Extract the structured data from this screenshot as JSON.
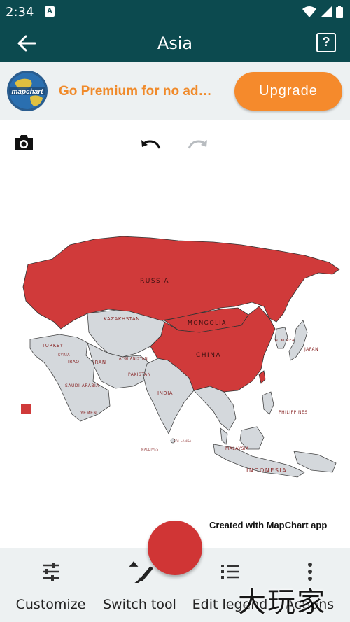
{
  "status_bar": {
    "time": "2:34",
    "notification_letter": "A"
  },
  "app_bar": {
    "title": "Asia",
    "help_symbol": "?"
  },
  "promo": {
    "logo_text": "mapchart",
    "text": "Go Premium for no ad…",
    "button_label": "Upgrade"
  },
  "toolbar": {
    "camera_icon": "camera-icon",
    "undo_icon": "undo-icon",
    "redo_icon": "redo-icon"
  },
  "map": {
    "selected_color": "#d03a3a",
    "default_color": "#d4d8dc",
    "red_labels": [
      "RUSSIA",
      "MONGOLIA",
      "CHINA"
    ],
    "labels": {
      "russia": "RUSSIA",
      "mongolia": "MONGOLIA",
      "china": "CHINA",
      "kazakhstan": "KAZAKHSTAN",
      "turkey": "TURKEY",
      "iran": "IRAN",
      "iraq": "IRAQ",
      "syria": "SYRIA",
      "saudi": "SAUDI ARABIA",
      "yemen": "YEMEN",
      "pakistan": "PAKISTAN",
      "afghanistan": "AFGHANISTAN",
      "india": "INDIA",
      "japan": "JAPAN",
      "nkorea": "N. KOREA",
      "philippines": "PHILIPPINES",
      "malaysia": "MALAYSIA",
      "indonesia": "INDONESIA",
      "srilanka": "SRI LANKA",
      "maldives": "MALDIVES"
    },
    "credit": "Created with MapChart app"
  },
  "bottom_nav": {
    "items": [
      {
        "label": "Customize",
        "icon": "sliders-icon"
      },
      {
        "label": "Switch tool",
        "icon": "brush-icon"
      },
      {
        "label": "Edit legend",
        "icon": "list-icon"
      },
      {
        "label": "Actions",
        "icon": "more-vertical-icon"
      }
    ]
  },
  "fab": {
    "color": "#d03535"
  },
  "watermark": {
    "text": "大玩家"
  }
}
